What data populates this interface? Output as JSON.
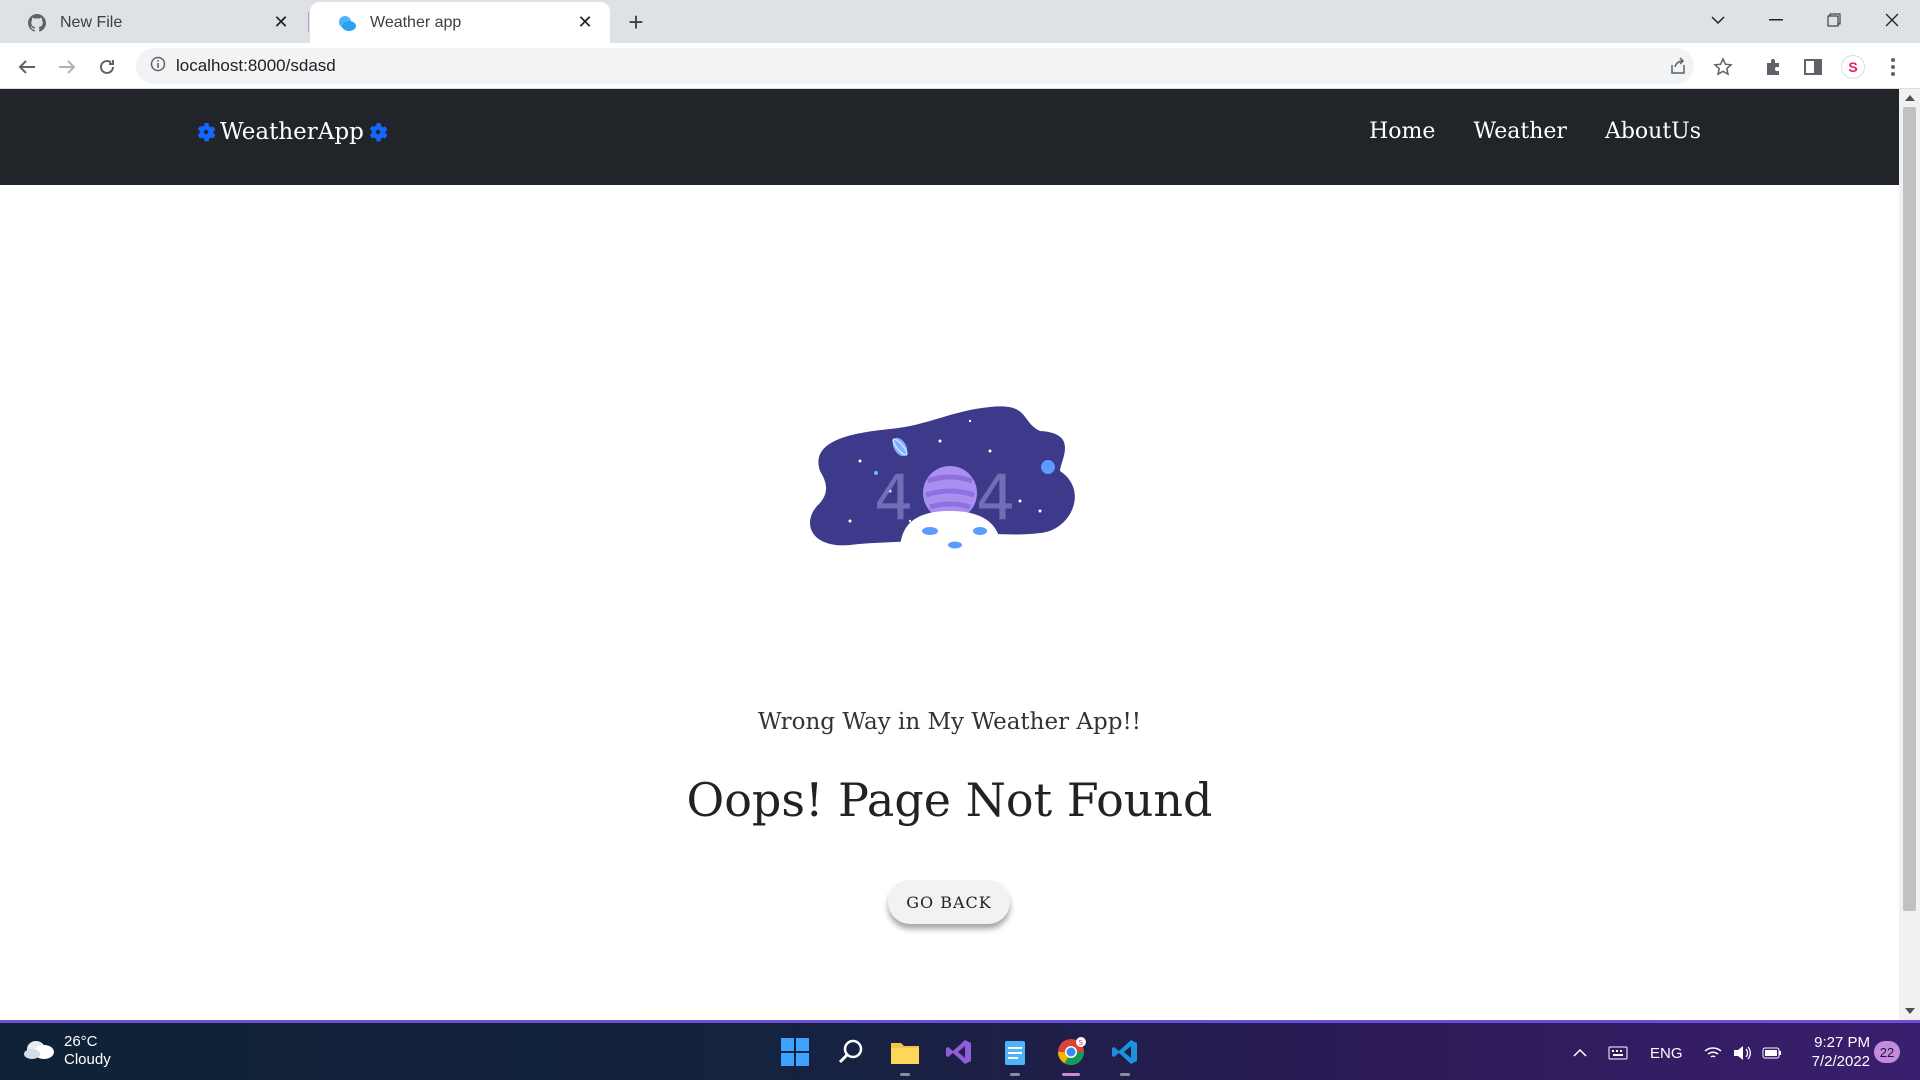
{
  "browser": {
    "tabs": [
      {
        "title": "New File",
        "icon": "github-icon",
        "active": false
      },
      {
        "title": "Weather app",
        "icon": "cloud-icon",
        "active": true
      }
    ],
    "url": "localhost:8000/sdasd"
  },
  "site": {
    "brand": "WeatherApp",
    "nav": [
      "Home",
      "Weather",
      "AboutUs"
    ]
  },
  "error_page": {
    "illustration_text": "404",
    "subtitle": "Wrong Way in My Weather App!!",
    "headline": "Oops! Page Not Found",
    "button_label": "GO BACK"
  },
  "taskbar": {
    "weather_temp": "26°C",
    "weather_condition": "Cloudy",
    "language": "ENG",
    "time": "9:27 PM",
    "date": "7/2/2022",
    "notification_count": "22"
  },
  "colors": {
    "navbar": "#212529",
    "brand_gear": "#1565ff",
    "illustration_bg": "#3d3a8c",
    "planet": "#a98ff0"
  }
}
